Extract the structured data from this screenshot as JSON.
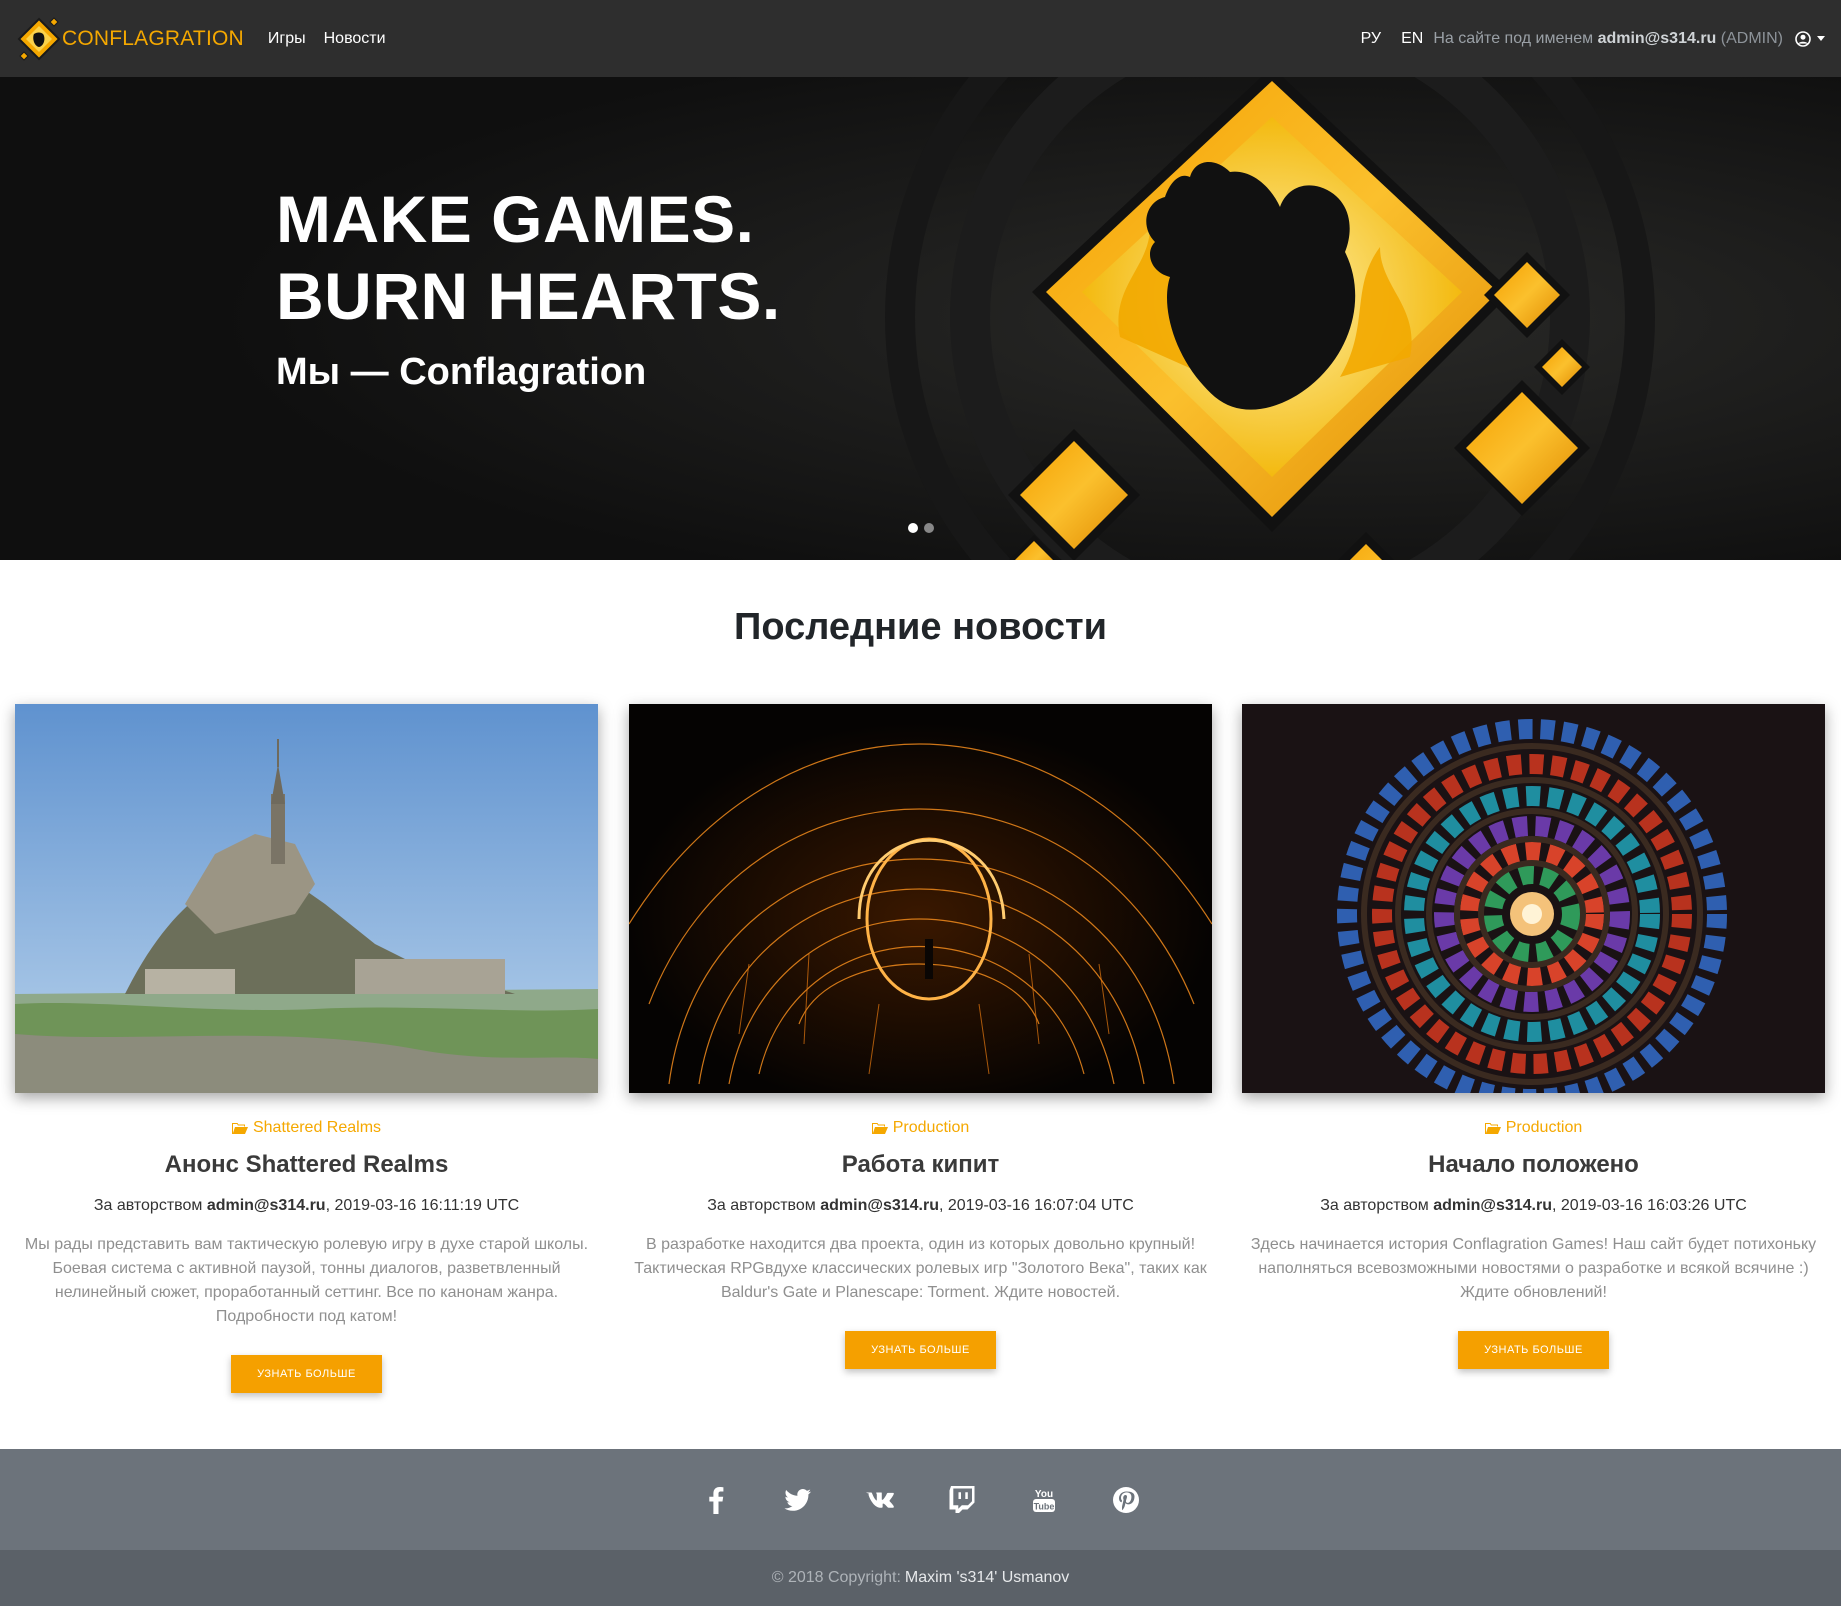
{
  "nav": {
    "brand": "CONFLAGRATION",
    "links": [
      "Игры",
      "Новости"
    ],
    "lang_ru": "РУ",
    "lang_en": "EN",
    "user_prefix": "На сайте под именем",
    "user_email": "admin@s314.ru",
    "user_role": "(ADMIN)"
  },
  "hero": {
    "line1": "MAKE GAMES.",
    "line2": "BURN HEARTS.",
    "subtitle": "Мы — Conflagration",
    "slides": 2,
    "active_slide": 1
  },
  "news": {
    "title": "Последние новости",
    "author_prefix": "За авторством",
    "button_label": "УЗНАТЬ БОЛЬШЕ",
    "items": [
      {
        "category": "Shattered Realms",
        "title": "Анонс Shattered Realms",
        "author": "admin@s314.ru",
        "date": ", 2019-03-16 16:11:19 UTC",
        "excerpt": "Мы рады представить вам тактическую ролевую игру в духе старой школы. Боевая система с активной паузой, тонны диалогов, разветвленный нелинейный сюжет, проработанный сеттинг. Все по канонам жанра. Подробности под катом!"
      },
      {
        "category": "Production",
        "title": "Работа кипит",
        "author": "admin@s314.ru",
        "date": ", 2019-03-16 16:07:04 UTC",
        "excerpt": "В разработке находится два проекта, один из которых довольно крупный! Тактическая RPGвдухе классических ролевых игр \"Золотого Века\", таких как Baldur's Gate и Planescape: Torment. Ждите новостей."
      },
      {
        "category": "Production",
        "title": "Начало положено",
        "author": "admin@s314.ru",
        "date": ", 2019-03-16 16:03:26 UTC",
        "excerpt": "Здесь начинается история Conflagration Games! Наш сайт будет потихоньку наполняться всевозможными новостями о разработке и всякой всячине :) Ждите обновлений!"
      }
    ]
  },
  "footer": {
    "social": [
      "facebook-icon",
      "twitter-icon",
      "vk-icon",
      "twitch-icon",
      "youtube-icon",
      "pinterest-icon"
    ],
    "copyright": "© 2018 Copyright:",
    "author": "Maxim 's314' Usmanov"
  },
  "colors": {
    "accent": "#f5a800",
    "navbar": "#2e2e2e",
    "footer": "#6c737b",
    "footer_bottom": "#5b6168"
  }
}
